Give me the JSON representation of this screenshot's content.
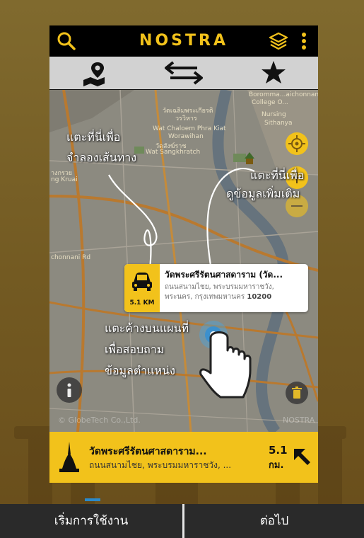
{
  "app": {
    "title": "NOSTRA"
  },
  "tabs": [
    {
      "name": "map-pin-icon",
      "selected": true
    },
    {
      "name": "route-arrows-icon",
      "selected": false
    },
    {
      "name": "star-icon",
      "selected": false
    }
  ],
  "map_labels": {
    "l1": "Boromma...aichonnani",
    "l2": "College O...",
    "l3": "Nursing",
    "l4": "Sithanya",
    "l5": "วัดเฉลิมพระเกียรติ",
    "l6": "วรวิหาร",
    "l7": "Wat Chaloem Phra Kiat",
    "l8": "Worawihan",
    "l9": "วัดสังฆ์ราช",
    "l10": "Wat Sangkhratch",
    "l11": "างกรวย",
    "l12": "ng Kruai",
    "l13": "chonnani Rd",
    "l14": "© GlobeTech Co.,Ltd.",
    "l15": "NOSTRA"
  },
  "hints": {
    "route_line1": "แตะที่นี่เพื่อ",
    "route_line2": "จำลองเส้นทาง",
    "info_line1": "แตะที่นี่เพื่อ",
    "info_line2": "ดูข้อมูลเพิ่มเติม",
    "hold_line1": "แตะค้างบนแผนที่",
    "hold_line2": "เพื่อสอบถาม",
    "hold_line3": "ข้อมูลตำแหน่ง"
  },
  "popup": {
    "distance": "5.1 KM",
    "title": "วัดพระศรีรัตนศาสดาราม (วัด...",
    "address_line1": "ถนนสนามไชย, พระบรมมหาราชวัง,",
    "address_line2": "พระนคร, กรุงเทพมหานคร",
    "postcode": "10200"
  },
  "bottom_card": {
    "title": "วัดพระศรีรัตนศาสดาราม...",
    "address": "ถนนสนามไชย, พระบรมมหาราชวัง, ...",
    "distance": "5.1",
    "unit": "กม."
  },
  "footer": {
    "start_label": "เริ่มการใช้งาน",
    "next_label": "ต่อไป"
  },
  "colors": {
    "accent": "#f2c21b",
    "bar": "#000000",
    "footer": "#2a2a2a"
  }
}
